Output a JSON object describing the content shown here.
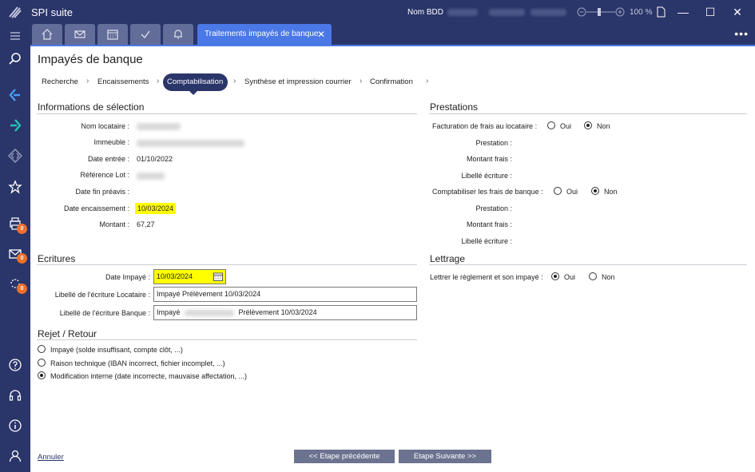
{
  "window": {
    "app_title": "SPI suite",
    "db_label": "Nom BDD",
    "zoom": "100 %",
    "minimize": "—",
    "maximize": "☐",
    "close": "✕"
  },
  "tabs": {
    "active_label": "Traitements impayés de banque",
    "close_glyph": "✕",
    "more": "•••"
  },
  "sidebar": {
    "badges": [
      "0",
      "0",
      "0"
    ]
  },
  "page": {
    "title": "Impayés de banque"
  },
  "breadcrumb": {
    "steps": [
      "Recherche",
      "Encaissements",
      "Comptabilisation",
      "Synthèse et impression courrier",
      "Confirmation"
    ],
    "separator": "›"
  },
  "selection": {
    "title": "Informations de sélection",
    "fields": [
      {
        "label": "Nom locataire :",
        "value": ""
      },
      {
        "label": "Immeuble :",
        "value": ""
      },
      {
        "label": "Date entrée :",
        "value": "01/10/2022"
      },
      {
        "label": "Référence Lot :",
        "value": ""
      },
      {
        "label": "Date fin préavis :",
        "value": ""
      },
      {
        "label": "Date encaissement :",
        "value": "10/03/2024"
      },
      {
        "label": "Montant :",
        "value": "67,27"
      }
    ]
  },
  "prestations": {
    "title": "Prestations",
    "facturation_label": "Facturation de frais au locataire :",
    "comptabiliser_label": "Comptabiliser les frais de banque :",
    "oui": "Oui",
    "non": "Non",
    "prestation_label": "Prestation :",
    "montant_frais_label": "Montant frais :",
    "libelle_label": "Libellé écriture :"
  },
  "ecritures": {
    "title": "Ecritures",
    "date_label": "Date Impayé :",
    "date_value": "10/03/2024",
    "libelle_locataire_label": "Libellé de l'écriture Locataire :",
    "libelle_locataire_value": "Impayé Prélèvement 10/03/2024",
    "libelle_banque_label": "Libellé de l'écriture Banque :",
    "libelle_banque_prefix": "Impayé",
    "libelle_banque_suffix": "Prélèvement 10/03/2024"
  },
  "lettrage": {
    "title": "Lettrage",
    "label": "Lettrer le règlement et son impayé :",
    "oui": "Oui",
    "non": "Non"
  },
  "rejet": {
    "title": "Rejet / Retour",
    "options": [
      "Impayé (solde insuffisant, compte clôt, ...)",
      "Raison technique (IBAN incorrect, fichier incomplet, ...)",
      "Modification interne (date incorrecte, mauvaise affectation, ...)"
    ]
  },
  "footer": {
    "cancel": "Annuler",
    "prev": "<< Etape précédente",
    "next": "Etape Suivante >>"
  },
  "colors": {
    "chrome": "#2a3569",
    "accent": "#4a78e6",
    "highlight": "#ffff00",
    "badge": "#f06f2a"
  }
}
